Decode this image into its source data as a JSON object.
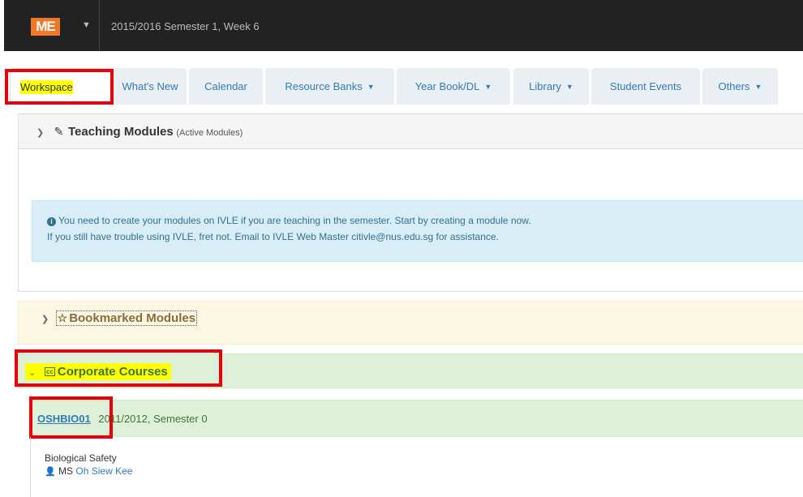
{
  "navbar": {
    "logo": "ME",
    "semester": "2015/2016 Semester 1, Week 6"
  },
  "tabs": [
    {
      "label": "Workspace",
      "dropdown": false
    },
    {
      "label": "What's New",
      "dropdown": false
    },
    {
      "label": "Calendar",
      "dropdown": false
    },
    {
      "label": "Resource Banks",
      "dropdown": true
    },
    {
      "label": "Year Book/DL",
      "dropdown": true
    },
    {
      "label": "Library",
      "dropdown": true
    },
    {
      "label": "Student Events",
      "dropdown": false
    },
    {
      "label": "Others",
      "dropdown": true
    }
  ],
  "teaching": {
    "title": "Teaching Modules",
    "subtitle": "(Active Modules)",
    "alert_line1": "You need to create your modules on IVLE if you are teaching in the semester. Start by creating a module now.",
    "alert_line2": "If you still have trouble using IVLE, fret not. Email to IVLE Web Master citivle@nus.edu.sg for assistance."
  },
  "bookmarked": {
    "title": "Bookmarked Modules"
  },
  "corporate": {
    "title": "Corporate Courses",
    "module": {
      "code": "OSHBIO01",
      "term": "2011/2012, Semester 0",
      "name": "Biological Safety",
      "lecturer_title": "MS",
      "lecturer_name": "Oh Siew Kee"
    }
  },
  "colors": {
    "highlight": "#ffff00",
    "annotation_box": "#e8000b",
    "link": "#337ab7"
  }
}
